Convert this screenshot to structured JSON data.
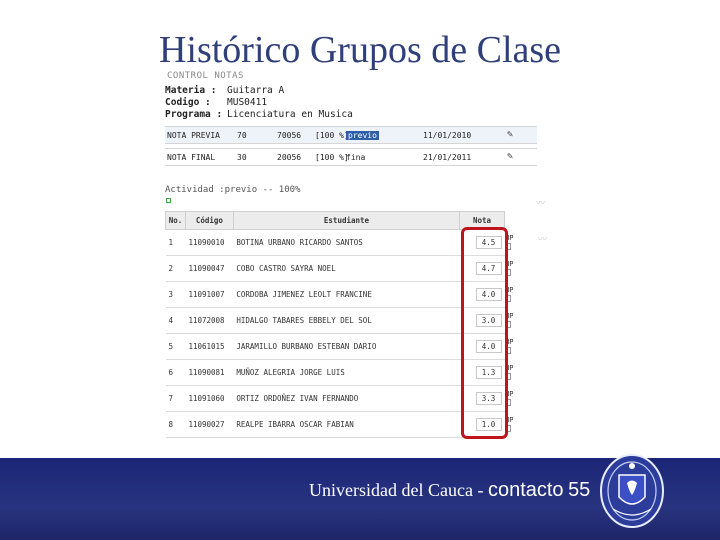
{
  "slide": {
    "title": "Histórico Grupos de Clase"
  },
  "screenshot": {
    "section_label": "CONTROL NOTAS",
    "materia_label": "Materia :",
    "materia_value": "Guitarra A",
    "codigo_label": "Codigo :",
    "codigo_value": "MUS0411",
    "programa_label": "Programa :",
    "programa_value": "Licenciatura en Musica",
    "nota_rows": [
      {
        "label": "NOTA PREVIA",
        "value": "70",
        "code": "70056",
        "range": "[100 %]",
        "tag": "previo",
        "date": "11/01/2010"
      },
      {
        "label": "NOTA FINAL",
        "value": "30",
        "code": "20056",
        "range": "[100 %]",
        "tag": "fina",
        "date": "21/01/2011"
      }
    ],
    "actividad": "Actividad :previo -- 100%",
    "table": {
      "headers": [
        "No.",
        "Código",
        "Estudiante",
        "Nota"
      ],
      "rows": [
        {
          "no": "1",
          "codigo": "11090010",
          "estudiante": "BOTINA URBANO RICARDO SANTOS",
          "nota": "4.5",
          "np": "NP"
        },
        {
          "no": "2",
          "codigo": "11090047",
          "estudiante": "COBO CASTRO SAYRA NOEL",
          "nota": "4.7",
          "np": "NP"
        },
        {
          "no": "3",
          "codigo": "11091007",
          "estudiante": "CORDOBA JIMENEZ LEOLT FRANCINE",
          "nota": "4.0",
          "np": "NP"
        },
        {
          "no": "4",
          "codigo": "11072008",
          "estudiante": "HIDALGO TABARES EBBELY DEL SOL",
          "nota": "3.0",
          "np": "NP"
        },
        {
          "no": "5",
          "codigo": "11061015",
          "estudiante": "JARAMILLO BURBANO ESTEBAN DARIO",
          "nota": "4.0",
          "np": "NP"
        },
        {
          "no": "6",
          "codigo": "11090081",
          "estudiante": "MUÑOZ ALEGRIA JORGE LUIS",
          "nota": "1.3",
          "np": "NP"
        },
        {
          "no": "7",
          "codigo": "11091060",
          "estudiante": "ORTIZ ORDOÑEZ IVAN FERNANDO",
          "nota": "3.3",
          "np": "NP"
        },
        {
          "no": "8",
          "codigo": "11090027",
          "estudiante": "REALPE IBARRA OSCAR FABIAN",
          "nota": "1.0",
          "np": "NP"
        }
      ]
    }
  },
  "footer": {
    "university": "Universidad del Cauca",
    "separator": "-",
    "contacto": "contacto",
    "page_number": "55"
  },
  "colors": {
    "title": "#2f3f7a",
    "footer_bg": "#1c2577",
    "highlight": "#c0141c"
  }
}
